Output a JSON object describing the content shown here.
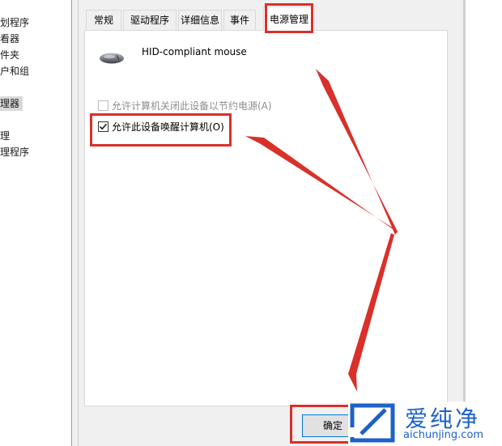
{
  "left_tree": {
    "items": [
      {
        "label": "划程序",
        "selected": false
      },
      {
        "label": "看器",
        "selected": false
      },
      {
        "label": "件夹",
        "selected": false
      },
      {
        "label": "户和组",
        "selected": false
      },
      {
        "label": "理器",
        "selected": true
      },
      {
        "label": "理",
        "selected": false
      },
      {
        "label": "理程序",
        "selected": false
      }
    ]
  },
  "tabs": [
    {
      "label": "常规",
      "active": false
    },
    {
      "label": "驱动程序",
      "active": false
    },
    {
      "label": "详细信息",
      "active": false
    },
    {
      "label": "事件",
      "active": false
    },
    {
      "label": "电源管理",
      "active": true
    }
  ],
  "device": {
    "icon": "mouse-icon",
    "name": "HID-compliant mouse"
  },
  "options": [
    {
      "label": "允许计算机关闭此设备以节约电源(A)",
      "checked": false,
      "enabled": false
    },
    {
      "label": "允许此设备唤醒计算机(O)",
      "checked": true,
      "enabled": true
    }
  ],
  "buttons": {
    "ok": "确定"
  },
  "annotation": {
    "color": "#d9302a"
  },
  "watermark": {
    "brand": "爱纯净",
    "url": "aichunjing.com",
    "color": "#1c62c9"
  }
}
